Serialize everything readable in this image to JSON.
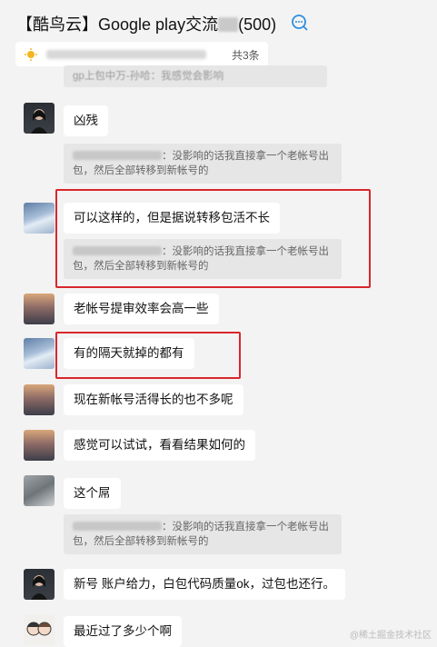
{
  "header": {
    "title_prefix": "【酷鸟云】Google play交流",
    "title_suffix": "(500)",
    "notice_count": "共3条",
    "top_quote": "gp上包中万-孙哈：我感觉会影响"
  },
  "messages": [
    {
      "text": "凶残",
      "quote": "：没影响的话我直接拿一个老帐号出包，然后全部转移到新帐号的"
    },
    {
      "text": "可以这样的，但是据说转移包活不长",
      "quote": "：没影响的话我直接拿一个老帐号出包，然后全部转移到新帐号的"
    },
    {
      "text": "老帐号提审效率会高一些"
    },
    {
      "text": "有的隔天就掉的都有"
    },
    {
      "text": "现在新帐号活得长的也不多呢"
    },
    {
      "text": "感觉可以试试，看看结果如何的"
    },
    {
      "text": "这个屌",
      "quote": "：没影响的话我直接拿一个老帐号出包，然后全部转移到新帐号的"
    },
    {
      "text": "新号 账户给力，白包代码质量ok，过包也还行。"
    },
    {
      "text": "最近过了多少个啊"
    }
  ],
  "watermark": "@稀土掘金技术社区"
}
